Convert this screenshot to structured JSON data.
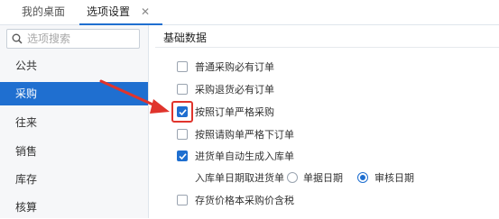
{
  "tabs": {
    "home_label": "我的桌面",
    "options_label": "选项设置",
    "close_glyph": "✕"
  },
  "sidebar": {
    "search_placeholder": "选项搜索",
    "items": [
      {
        "label": "公共"
      },
      {
        "label": "采购"
      },
      {
        "label": "往来"
      },
      {
        "label": "销售"
      },
      {
        "label": "库存"
      },
      {
        "label": "核算"
      }
    ],
    "active_item": "采购"
  },
  "main": {
    "section_title": "基础数据",
    "options": [
      {
        "label": "普通采购必有订单",
        "checked": false
      },
      {
        "label": "采购退货必有订单",
        "checked": false
      },
      {
        "label": "按照订单严格采购",
        "checked": true
      },
      {
        "label": "按照请购单严格下订单",
        "checked": false
      },
      {
        "label": "进货单自动生成入库单",
        "checked": true
      },
      {
        "label": "存货价格本采购价含税",
        "checked": false
      }
    ],
    "inbound_date": {
      "label": "入库单日期取进货单",
      "choices": [
        {
          "label": "单据日期",
          "selected": false
        },
        {
          "label": "审核日期",
          "selected": true
        }
      ]
    }
  },
  "colors": {
    "accent": "#1f6fd0",
    "annotation_red": "#e0342c"
  },
  "icons": {
    "search": "search-icon",
    "check": "checkmark-icon",
    "close": "close-icon",
    "pointer": "red-arrow-icon"
  }
}
